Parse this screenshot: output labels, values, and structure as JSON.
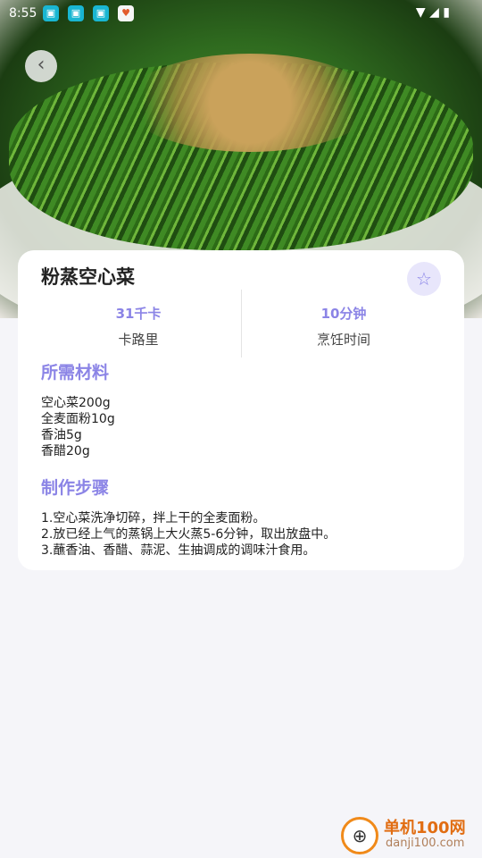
{
  "status_bar": {
    "time": "8:55",
    "notifications": [
      "app-icon",
      "app-icon",
      "app-icon",
      "heart-app-icon"
    ],
    "system_icons": "wifi signal battery"
  },
  "recipe": {
    "title": "粉蒸空心菜",
    "stats": [
      {
        "value": "31千卡",
        "label": "卡路里"
      },
      {
        "value": "10分钟",
        "label": "烹饪时间"
      }
    ],
    "ingredients_title": "所需材料",
    "ingredients": [
      "空心菜200g",
      "全麦面粉10g",
      "香油5g",
      "香醋20g"
    ],
    "steps_title": "制作步骤",
    "steps": [
      "1.空心菜洗净切碎，拌上干的全麦面粉。",
      "2.放已经上气的蒸锅上大火蒸5-6分钟，取出放盘中。",
      "3.蘸香油、香醋、蒜泥、生抽调成的调味汁食用。"
    ]
  },
  "watermark": {
    "line1": "单机100网",
    "line2": "danji100.com"
  },
  "colors": {
    "accent": "#8b84e6",
    "background": "#f5f5f9"
  }
}
